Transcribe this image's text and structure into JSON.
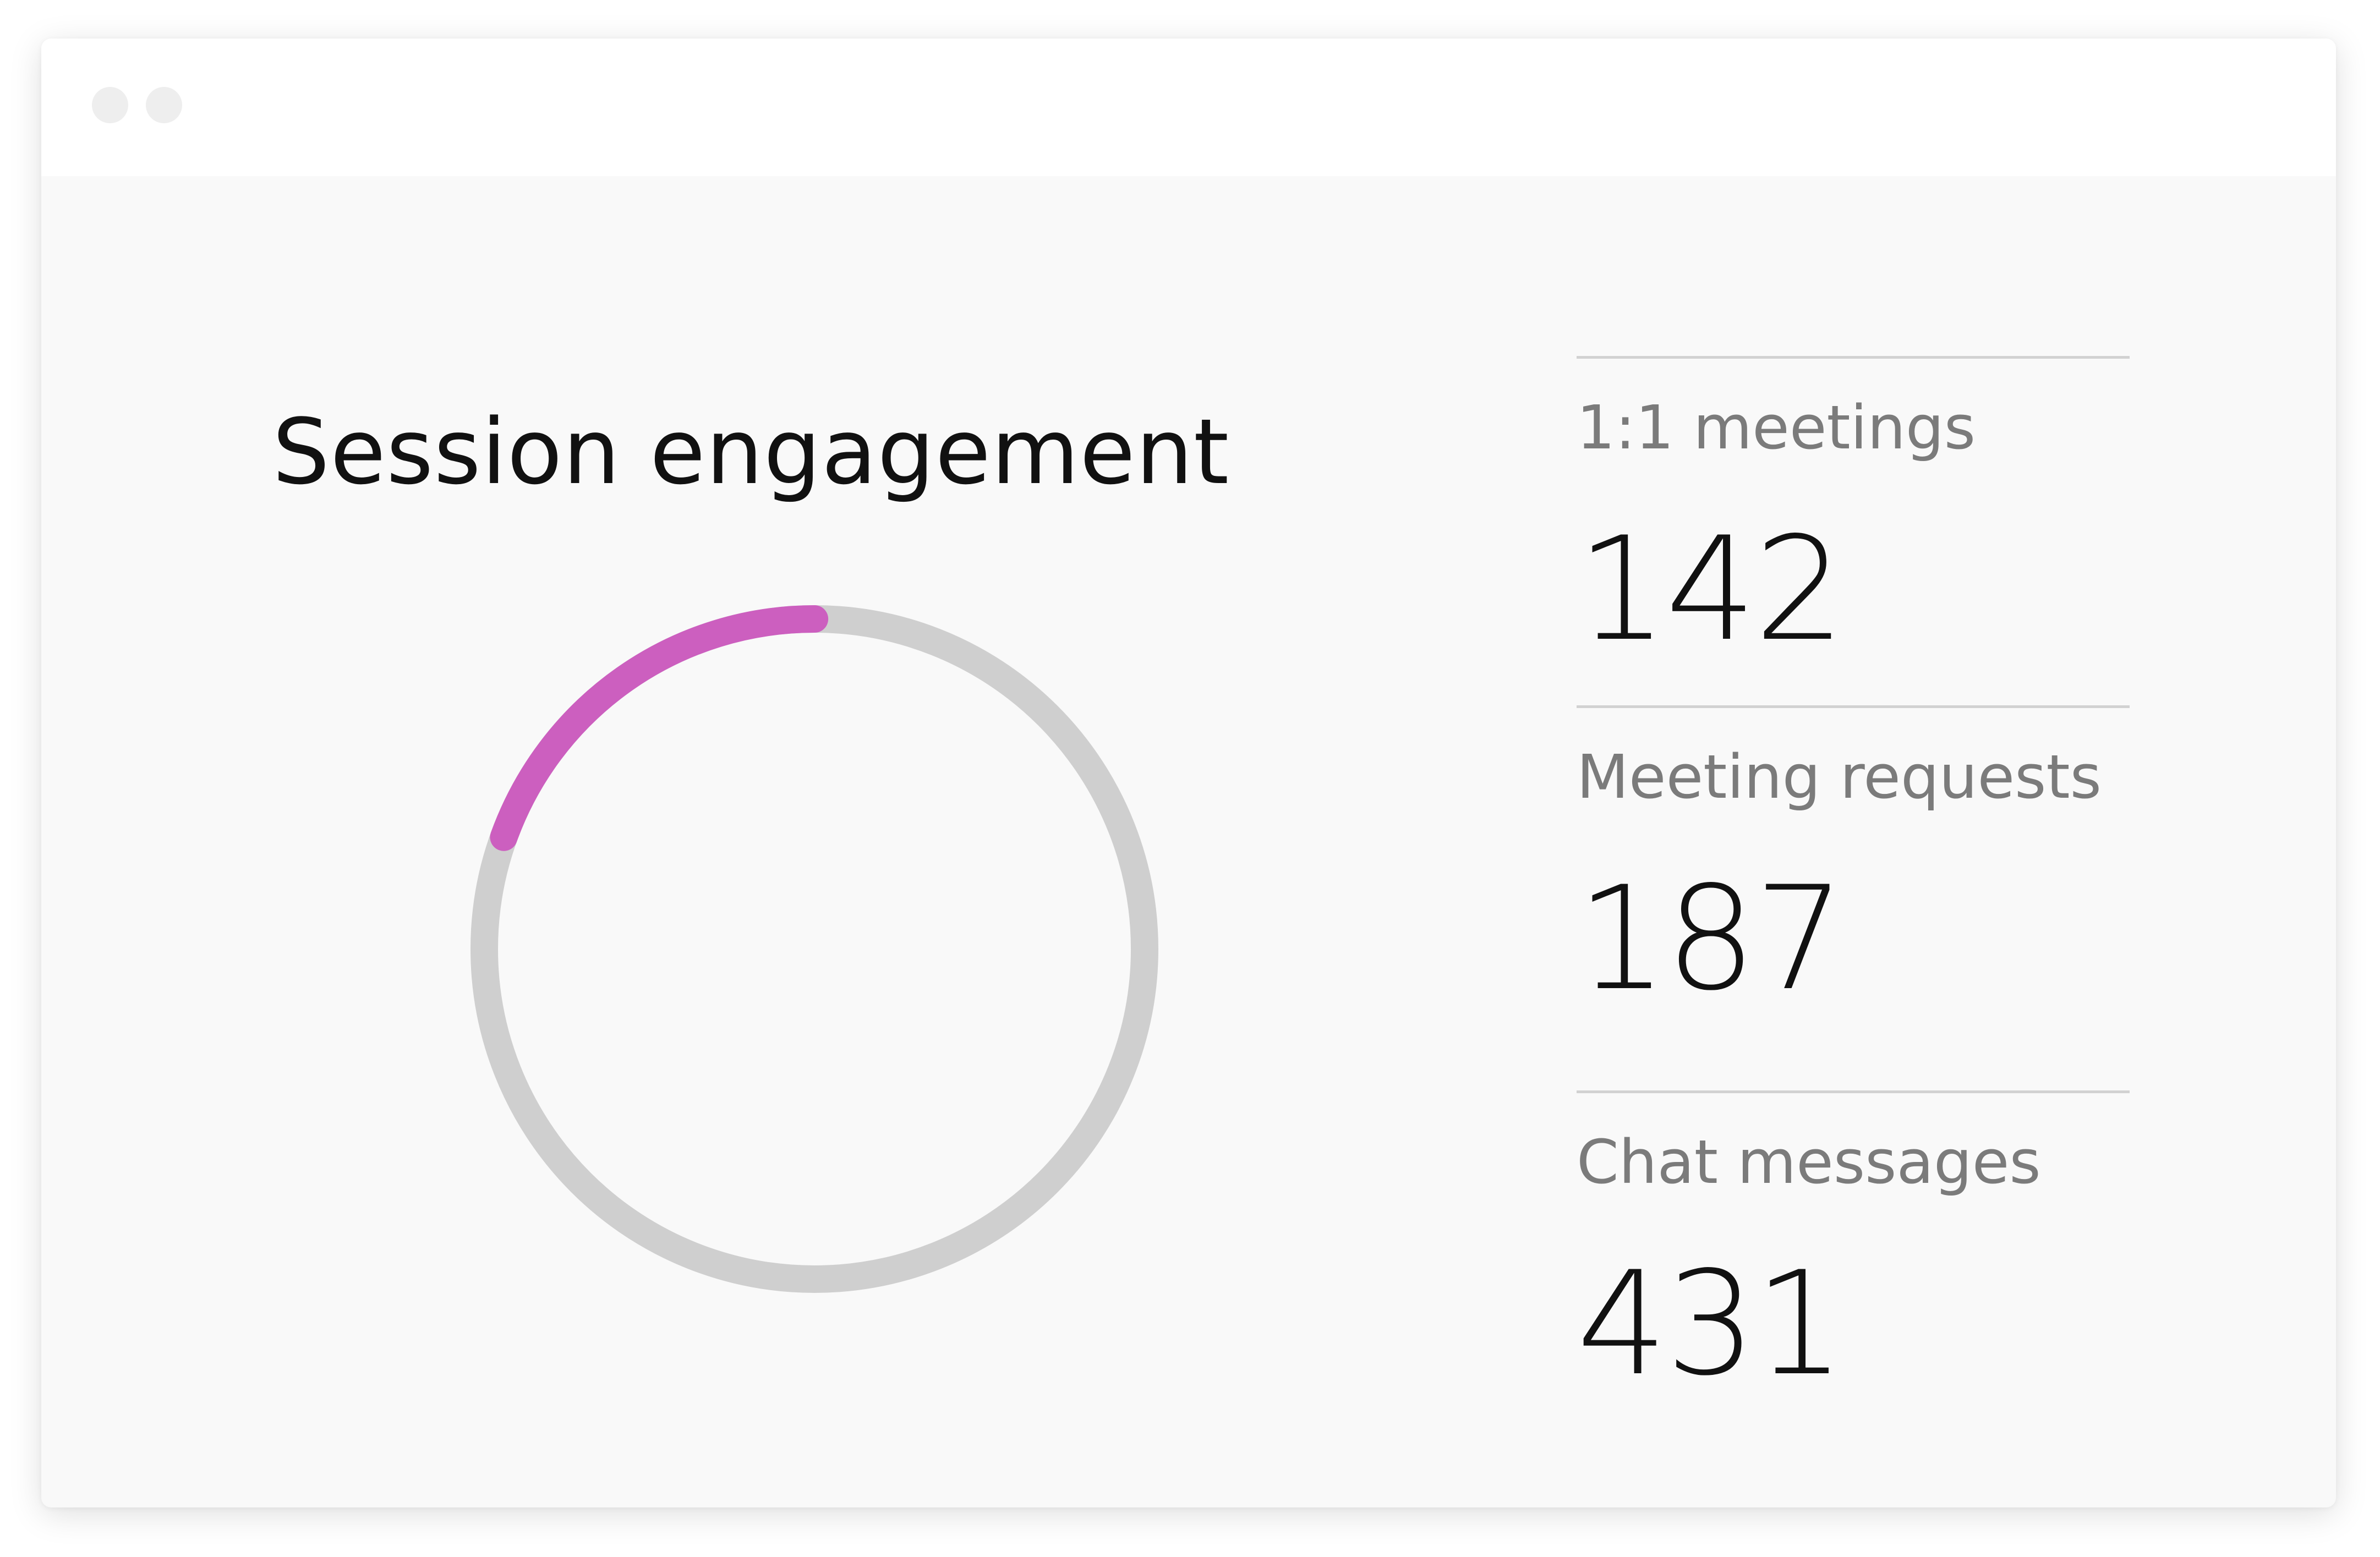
{
  "window": {
    "controls": [
      "window-dot",
      "window-dot"
    ]
  },
  "chart_data": {
    "type": "donut",
    "title": "Session engagement",
    "highlight_fraction": 0.195,
    "colors": {
      "highlight": "#cc5fbf",
      "track": "#cfcfcf"
    }
  },
  "stats": [
    {
      "label": "1:1 meetings",
      "value": "142"
    },
    {
      "label": "Meeting requests",
      "value": "187"
    },
    {
      "label": "Chat messages",
      "value": "431"
    }
  ]
}
